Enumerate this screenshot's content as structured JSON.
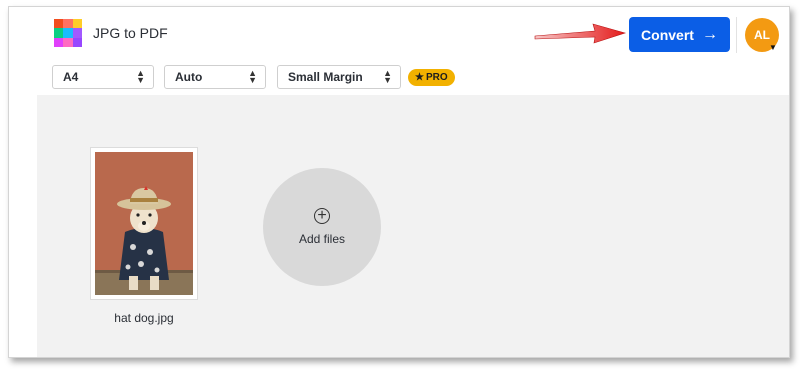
{
  "header": {
    "app_title": "JPG to PDF",
    "convert_label": "Convert",
    "convert_arrow": "→",
    "avatar_initials": "AL",
    "avatar_caret": "▼",
    "accent_color": "#0b5ee6",
    "avatar_color": "#f39a12",
    "logo_colors": [
      "#f24e1e",
      "#ff7262",
      "#ffcd29",
      "#0acf83",
      "#1abcfe",
      "#a259ff",
      "#e040fb",
      "#ff6ac1",
      "#9747ff"
    ]
  },
  "toolbar": {
    "page_size": "A4",
    "orientation": "Auto",
    "margin": "Small Margin",
    "pro_badge": "PRO",
    "pro_star": "★",
    "pro_color": "#f2b100"
  },
  "workspace": {
    "files": [
      {
        "name": "hat dog.jpg"
      }
    ],
    "add_files_label": "Add files",
    "add_icon": "⊕"
  }
}
